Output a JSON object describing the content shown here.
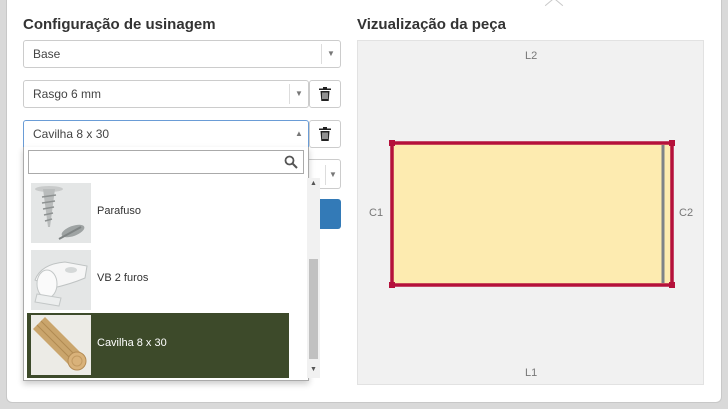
{
  "left": {
    "title": "Configuração de usinagem",
    "select_base": "Base",
    "select_rasgo": "Rasgo 6 mm",
    "select_open": "Cavilha 8 x 30",
    "search_value": "",
    "options": [
      {
        "label": "Parafuso",
        "icon": "screw-icon"
      },
      {
        "label": "VB 2 furos",
        "icon": "vb-connector-icon"
      },
      {
        "label": "Cavilha 8 x 30",
        "icon": "dowel-icon",
        "selected": true
      }
    ]
  },
  "right": {
    "title": "Vizualização da peça",
    "labels": {
      "top": "L2",
      "bottom": "L1",
      "left": "C1",
      "right": "C2"
    }
  },
  "colors": {
    "piece_fill": "#fdebb0",
    "piece_border": "#b5113b",
    "highlight": "#3d4a2a",
    "button": "#337ab7"
  }
}
